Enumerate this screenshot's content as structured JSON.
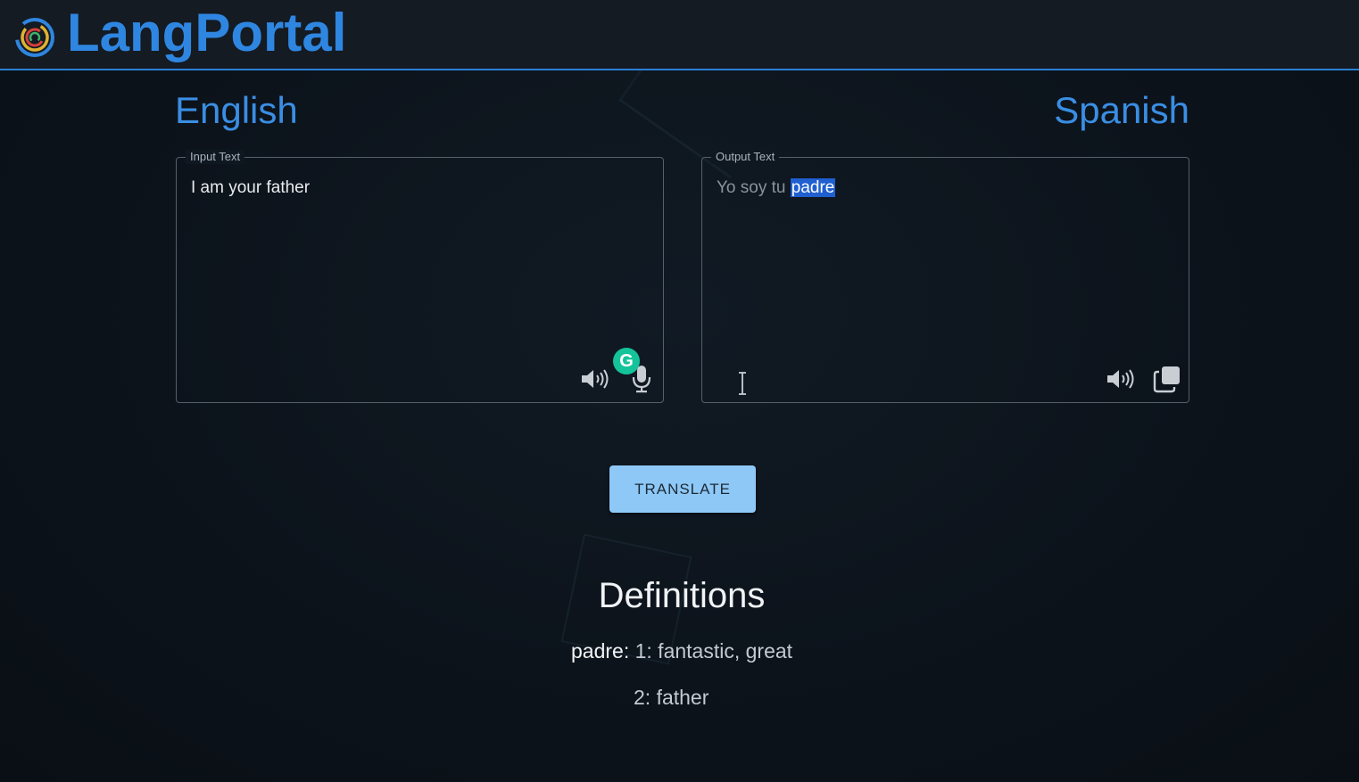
{
  "header": {
    "app_name": "LangPortal",
    "accent_color": "#2f86e0"
  },
  "source": {
    "language": "English",
    "legend": "Input Text",
    "value": "I am your father"
  },
  "target": {
    "language": "Spanish",
    "legend": "Output Text",
    "value_prefix": "Yo soy tu ",
    "value_selected": "padre"
  },
  "icons": {
    "speaker": "speaker-icon",
    "microphone": "microphone-icon",
    "copy": "copy-icon",
    "grammarly": "grammarly-icon"
  },
  "grammarly_badge": "G",
  "translate_button": {
    "label": "TRANSLATE",
    "color": "#8ec8f6"
  },
  "definitions": {
    "title": "Definitions",
    "word": "padre:",
    "entries": [
      "1: fantastic, great",
      "2: father"
    ]
  }
}
